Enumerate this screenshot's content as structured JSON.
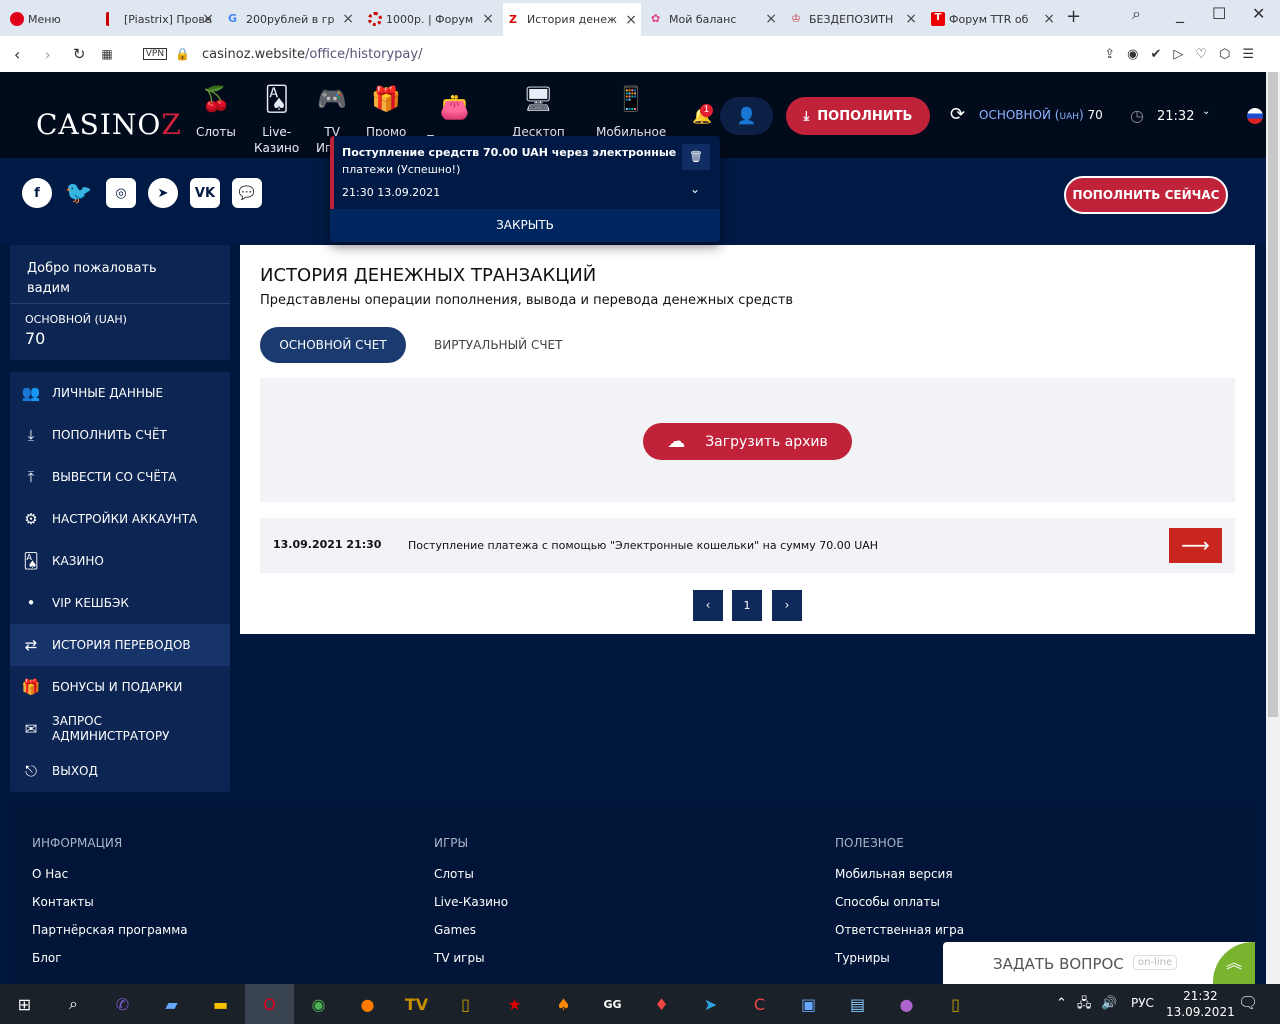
{
  "browser": {
    "menu": "Меню",
    "tabs": [
      "[Piastrix] Прове",
      "200рублей в гр",
      "1000р. | Форум",
      "История денеж",
      "Мой баланс",
      "БЕЗДЕПОЗИТН",
      "Форум TTR об"
    ],
    "url_host": "casinoz.website",
    "url_path": "/office/historypay/",
    "vpn": "VPN"
  },
  "header": {
    "logo": "CASINO-Z",
    "nav": [
      "Слоты",
      "Live-\nКазино",
      "TV\nИгры",
      "Промо",
      "Платежи",
      "Десктоп",
      "Мобильное"
    ],
    "notif_count": "1",
    "deposit": "ПОПОЛНИТЬ",
    "account_label": "ОСНОВНОЙ",
    "currency": "UAH",
    "balance": "70",
    "time": "21:32"
  },
  "notification": {
    "title": "Поступление средств 70.00 UAH через электронные",
    "title2": "платежи (Успешно!)",
    "time": "21:30 13.09.2021",
    "close": "ЗАКРЫТЬ"
  },
  "social": {
    "items": [
      "f",
      "t",
      "ig",
      "tg",
      "vk",
      "ch"
    ],
    "deposit_now": "ПОПОЛНИТЬ СЕЙЧАС"
  },
  "sidebar": {
    "welcome": "Добро пожаловать",
    "user": "вадим",
    "account": "ОСНОВНОЙ (UAH)",
    "balance": "70",
    "items": [
      {
        "icon": "user-plus",
        "label": "ЛИЧНЫЕ ДАННЫЕ"
      },
      {
        "icon": "download",
        "label": "ПОПОЛНИТЬ СЧЁТ"
      },
      {
        "icon": "upload",
        "label": "ВЫВЕСТИ СО СЧЁТА"
      },
      {
        "icon": "gears",
        "label": "НАСТРОЙКИ АККАУНТА"
      },
      {
        "icon": "cards",
        "label": "КАЗИНО"
      },
      {
        "icon": "dot",
        "label": "VIP КЕШБЭК"
      },
      {
        "icon": "arrows",
        "label": "ИСТОРИЯ ПЕРЕВОДОВ"
      },
      {
        "icon": "gift",
        "label": "БОНУСЫ И ПОДАРКИ"
      },
      {
        "icon": "envelope",
        "label": "ЗАПРОС\nАДМИНИСТРАТОРУ"
      },
      {
        "icon": "exit",
        "label": "ВЫХОД"
      }
    ]
  },
  "main": {
    "title": "ИСТОРИЯ ДЕНЕЖНЫХ ТРАНЗАКЦИЙ",
    "subtitle": "Представлены операции пополнения, вывода и перевода денежных средств",
    "tab_main": "ОСНОВНОЙ СЧЕТ",
    "tab_virtual": "ВИРТУАЛЬНЫЙ СЧЕТ",
    "download": "Загрузить архив",
    "rows": [
      {
        "date": "13.09.2021 21:30",
        "text": "Поступление платежа с помощью \"Электронные кошельки\" на сумму 70.00 UAH"
      }
    ],
    "pages": [
      "‹",
      "1",
      "›"
    ]
  },
  "footer": {
    "cols": [
      {
        "title": "ИНФОРМАЦИЯ",
        "links": [
          "О Нас",
          "Контакты",
          "Партнёрская программа",
          "Блог"
        ]
      },
      {
        "title": "ИГРЫ",
        "links": [
          "Слоты",
          "Live-Казино",
          "Games",
          "TV игры"
        ]
      },
      {
        "title": "ПОЛЕЗНОЕ",
        "links": [
          "Мобильная версия",
          "Способы оплаты",
          "Ответственная игра",
          "Турниры"
        ]
      }
    ]
  },
  "chat": {
    "label": "ЗАДАТЬ ВОПРОС",
    "status": "on-line"
  },
  "taskbar": {
    "lang": "РУС",
    "time": "21:32",
    "date": "13.09.2021"
  }
}
